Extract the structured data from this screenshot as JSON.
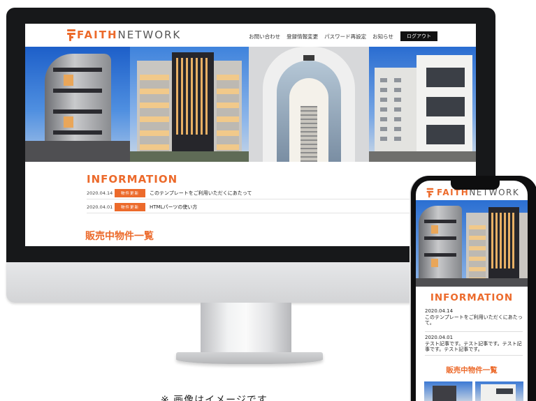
{
  "brand": {
    "logo_prefix": "F",
    "logo_accent": "AITH",
    "logo_suffix": "NETWORK",
    "accent_color": "#ec6a2b"
  },
  "nav": {
    "items": [
      "お問い合わせ",
      "登録情報変更",
      "パスワード再設定",
      "お知らせ"
    ],
    "logout_label": "ログアウト"
  },
  "desktop": {
    "info_title": "INFORMATION",
    "info_items": [
      {
        "date": "2020.04.14",
        "badge": "物件更新",
        "text": "このテンプレートをご利用いただくにあたって"
      },
      {
        "date": "2020.04.01",
        "badge": "物件更新",
        "text": "HTMLパーツの使い方"
      }
    ],
    "sale_title": "販売中物件一覧"
  },
  "mobile": {
    "info_title": "INFORMATION",
    "items": [
      {
        "date": "2020.04.14",
        "text": "このテンプレートをご利用いただくにあたって。"
      },
      {
        "date": "2020.04.01",
        "text": "テスト記事です。テスト記事です。テスト記事です。テスト記事です。"
      }
    ],
    "sale_title": "販売中物件一覧"
  },
  "caption": "※ 画像はイメージです",
  "icons": [
    "faith-logo-icon"
  ]
}
